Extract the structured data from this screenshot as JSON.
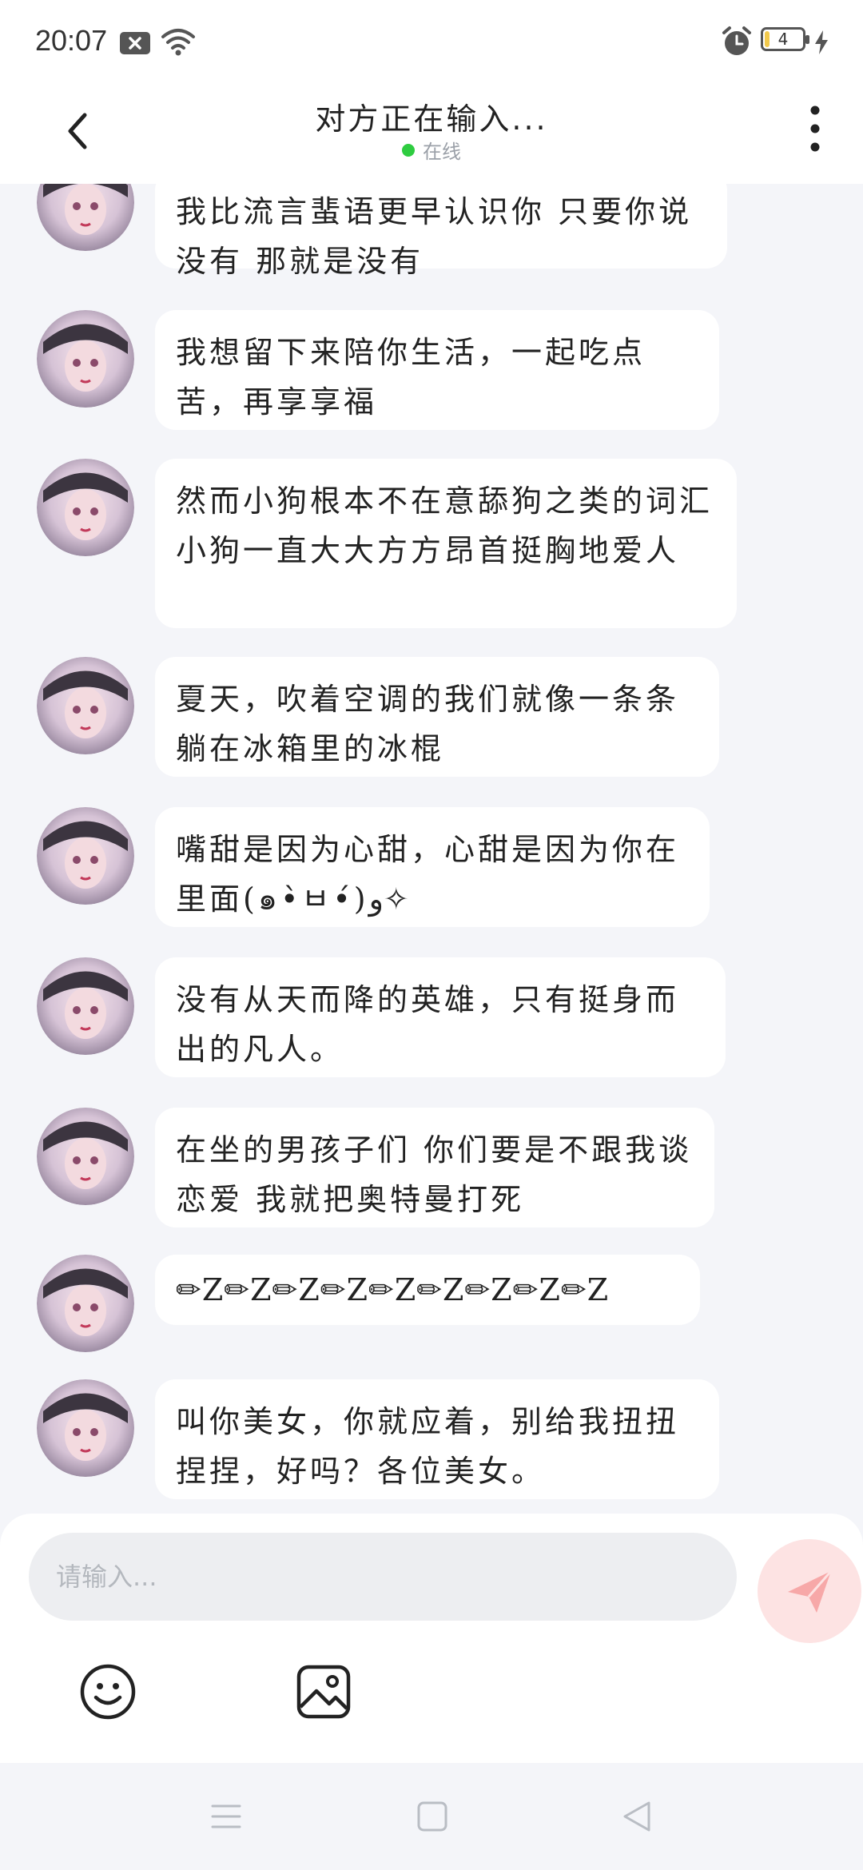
{
  "status_bar": {
    "time": "20:07",
    "battery_level": "4",
    "icons": [
      "notification-off-icon",
      "wifi-icon",
      "alarm-icon",
      "battery-icon",
      "charging-icon"
    ]
  },
  "header": {
    "title": "对方正在输入...",
    "status_text": "在线",
    "status_color": "#2ECC40",
    "icons": [
      "back-arrow-icon",
      "more-vertical-icon"
    ]
  },
  "messages": [
    {
      "text": "我比流言蜚语更早认识你 只要你说没有 那就是没有"
    },
    {
      "text": "我想留下来陪你生活，一起吃点苦，再享享福"
    },
    {
      "text": "然而小狗根本不在意舔狗之类的词汇 小狗一直大大方方昂首挺胸地爱人"
    },
    {
      "text": "夏天，吹着空调的我们就像一条条躺在冰箱里的冰棍"
    },
    {
      "text": "嘴甜是因为心甜，心甜是因为你在里面(๑•̀ㅂ•́)و✧"
    },
    {
      "text": "没有从天而降的英雄，只有挺身而出的凡人。"
    },
    {
      "text": "在坐的男孩子们 你们要是不跟我谈恋爱 我就把奥特曼打死"
    },
    {
      "text": "✏Z✏Z✏Z✏Z✏Z✏Z✏Z✏Z✏Z"
    },
    {
      "text": "叫你美女，你就应着，别给我扭扭捏捏，好吗？各位美女。"
    }
  ],
  "input": {
    "placeholder": "请输入...",
    "value": ""
  },
  "toolbar": {
    "icons": [
      "emoji-icon",
      "image-icon",
      "send-icon"
    ],
    "send_color": "#FDE3E3"
  },
  "navbar": {
    "icons": [
      "menu-icon",
      "home-icon",
      "back-icon"
    ]
  }
}
